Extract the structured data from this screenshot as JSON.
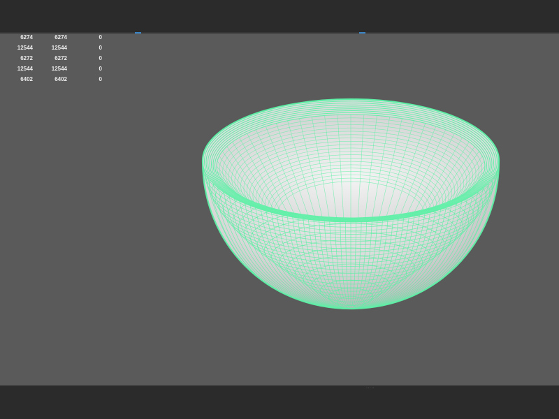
{
  "viewport": {
    "background": "#5a5a5a",
    "wireframe_color": "#5ef0a6",
    "object": "bowl-mesh"
  },
  "stats": {
    "rows": [
      {
        "col1": "6274",
        "col2": "6274",
        "col3": "0"
      },
      {
        "col1": "12544",
        "col2": "12544",
        "col3": "0"
      },
      {
        "col1": "6272",
        "col2": "6272",
        "col3": "0"
      },
      {
        "col1": "12544",
        "col2": "12544",
        "col3": "0"
      },
      {
        "col1": "6402",
        "col2": "6402",
        "col3": "0"
      }
    ]
  },
  "bottom_bar": {
    "stub_text": "....."
  }
}
